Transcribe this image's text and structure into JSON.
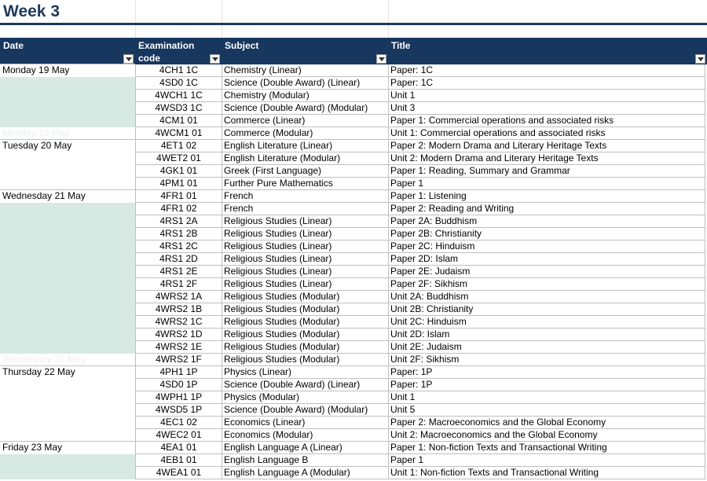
{
  "sheet_title": "Week 3",
  "headers": {
    "date": "Date",
    "code": "Examination code",
    "subject": "Subject",
    "title": "Title"
  },
  "colors": {
    "header_bg": "#17375e",
    "date_fill": "#d6e9e3",
    "title_text": "#1f3a5a"
  },
  "rows": [
    {
      "date": "Monday 19 May",
      "code": "4CH1 1C",
      "subject": "Chemistry (Linear)",
      "title": "Paper: 1C"
    },
    {
      "date": "",
      "code": "4SD0 1C",
      "subject": "Science (Double Award) (Linear)",
      "title": "Paper: 1C"
    },
    {
      "date": "",
      "code": "4WCH1 1C",
      "subject": "Chemistry (Modular)",
      "title": "Unit 1"
    },
    {
      "date": "",
      "code": "4WSD3 1C",
      "subject": "Science (Double Award) (Modular)",
      "title": "Unit 3"
    },
    {
      "date": "",
      "code": "4CM1 01",
      "subject": "Commerce (Linear)",
      "title": "Paper 1: Commercial operations and associated risks"
    },
    {
      "date": "Monday 19 May",
      "code": "4WCM1 01",
      "subject": "Commerce (Modular)",
      "title": "Unit 1: Commercial operations and associated risks"
    },
    {
      "date": "Tuesday 20 May",
      "code": "4ET1 02",
      "subject": "English Literature (Linear)",
      "title": "Paper 2: Modern Drama and Literary Heritage Texts"
    },
    {
      "date": "",
      "code": "4WET2 01",
      "subject": "English Literature (Modular)",
      "title": "Unit 2: Modern Drama and Literary Heritage Texts"
    },
    {
      "date": "",
      "code": "4GK1 01",
      "subject": "Greek (First Language)",
      "title": "Paper 1: Reading, Summary and Grammar"
    },
    {
      "date": "",
      "code": "4PM1 01",
      "subject": "Further Pure Mathematics",
      "title": "Paper 1"
    },
    {
      "date": "Wednesday 21 May",
      "code": "4FR1 01",
      "subject": "French",
      "title": "Paper 1: Listening"
    },
    {
      "date": "",
      "code": "4FR1 02",
      "subject": "French",
      "title": "Paper 2: Reading and Writing"
    },
    {
      "date": "",
      "code": "4RS1 2A",
      "subject": "Religious Studies (Linear)",
      "title": "Paper 2A: Buddhism"
    },
    {
      "date": "",
      "code": "4RS1 2B",
      "subject": "Religious Studies (Linear)",
      "title": "Paper 2B: Christianity"
    },
    {
      "date": "",
      "code": "4RS1 2C",
      "subject": "Religious Studies (Linear)",
      "title": "Paper 2C: Hinduism"
    },
    {
      "date": "",
      "code": "4RS1 2D",
      "subject": "Religious Studies (Linear)",
      "title": "Paper 2D: Islam"
    },
    {
      "date": "",
      "code": "4RS1 2E",
      "subject": "Religious Studies (Linear)",
      "title": "Paper 2E: Judaism"
    },
    {
      "date": "",
      "code": "4RS1 2F",
      "subject": "Religious Studies (Linear)",
      "title": "Paper 2F: Sikhism"
    },
    {
      "date": "",
      "code": "4WRS2 1A",
      "subject": "Religious Studies (Modular)",
      "title": "Unit 2A: Buddhism"
    },
    {
      "date": "",
      "code": "4WRS2 1B",
      "subject": "Religious Studies (Modular)",
      "title": "Unit 2B: Christianity"
    },
    {
      "date": "",
      "code": "4WRS2 1C",
      "subject": "Religious Studies (Modular)",
      "title": "Unit 2C: Hinduism"
    },
    {
      "date": "",
      "code": "4WRS2 1D",
      "subject": "Religious Studies (Modular)",
      "title": "Unit 2D: Islam"
    },
    {
      "date": "",
      "code": "4WRS2 1E",
      "subject": "Religious Studies (Modular)",
      "title": "Unit 2E: Judaism"
    },
    {
      "date": "Wednesday 21 May",
      "code": "4WRS2 1F",
      "subject": "Religious Studies (Modular)",
      "title": "Unit 2F: Sikhism"
    },
    {
      "date": "Thursday 22 May",
      "code": "4PH1 1P",
      "subject": "Physics (Linear)",
      "title": "Paper: 1P"
    },
    {
      "date": "",
      "code": "4SD0 1P",
      "subject": "Science (Double Award) (Linear)",
      "title": "Paper: 1P"
    },
    {
      "date": "",
      "code": "4WPH1 1P",
      "subject": "Physics (Modular)",
      "title": "Unit 1"
    },
    {
      "date": "",
      "code": "4WSD5 1P",
      "subject": "Science (Double Award) (Modular)",
      "title": "Unit 5"
    },
    {
      "date": "",
      "code": "4EC1 02",
      "subject": "Economics (Linear)",
      "title": "Paper 2: Macroeconomics and the Global Economy"
    },
    {
      "date": "",
      "code": "4WEC2 01",
      "subject": "Economics (Modular)",
      "title": "Unit 2: Macroeconomics and the Global Economy"
    },
    {
      "date": "Friday 23 May",
      "code": "4EA1 01",
      "subject": "English Language A (Linear)",
      "title": "Paper 1: Non-fiction Texts and Transactional Writing"
    },
    {
      "date": "",
      "code": "4EB1 01",
      "subject": "English Language B",
      "title": "Paper 1"
    },
    {
      "date": "",
      "code": "4WEA1 01",
      "subject": "English Language A (Modular)",
      "title": "Unit 1: Non-fiction Texts and Transactional Writing"
    }
  ]
}
